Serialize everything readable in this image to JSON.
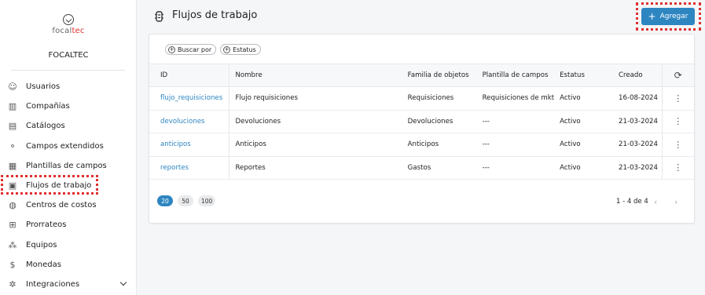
{
  "sidebar": {
    "brand": {
      "prefix": "focal",
      "suffix": "tec"
    },
    "org_name": "FOCALTEC",
    "items": [
      {
        "label": "Usuarios",
        "icon": "users-icon",
        "glyph": "☺"
      },
      {
        "label": "Compañías",
        "icon": "building-icon",
        "glyph": "▥"
      },
      {
        "label": "Catálogos",
        "icon": "catalog-icon",
        "glyph": "▤"
      },
      {
        "label": "Campos extendidos",
        "icon": "extended-fields-icon",
        "glyph": "⚬"
      },
      {
        "label": "Plantillas de campos",
        "icon": "template-icon",
        "glyph": "▦"
      },
      {
        "label": "Flujos de trabajo",
        "icon": "workflow-icon",
        "glyph": "▣"
      },
      {
        "label": "Centros de costos",
        "icon": "piggy-bank-icon",
        "glyph": "◍"
      },
      {
        "label": "Prorrateos",
        "icon": "split-icon",
        "glyph": "⊞"
      },
      {
        "label": "Equipos",
        "icon": "team-icon",
        "glyph": "⁂"
      },
      {
        "label": "Monedas",
        "icon": "coin-icon",
        "glyph": "$"
      },
      {
        "label": "Integraciones",
        "icon": "integration-icon",
        "glyph": "✲"
      }
    ]
  },
  "header": {
    "title": "Flujos de trabajo",
    "add_label": "Agregar"
  },
  "filters": {
    "search_by": "Buscar por",
    "status": "Estatus"
  },
  "table": {
    "columns": [
      "ID",
      "Nombre",
      "Familia de objetos",
      "Plantilla de campos",
      "Estatus",
      "Creado"
    ],
    "rows": [
      {
        "id": "flujo_requisiciones",
        "nombre": "Flujo requisiciones",
        "familia": "Requisiciones",
        "plantilla": "Requisiciones de mkt",
        "estatus": "Activo",
        "creado": "16-08-2024"
      },
      {
        "id": "devoluciones",
        "nombre": "Devoluciones",
        "familia": "Devoluciones",
        "plantilla": "---",
        "estatus": "Activo",
        "creado": "21-03-2024"
      },
      {
        "id": "anticipos",
        "nombre": "Anticipos",
        "familia": "Anticipos",
        "plantilla": "---",
        "estatus": "Activo",
        "creado": "21-03-2024"
      },
      {
        "id": "reportes",
        "nombre": "Reportes",
        "familia": "Gastos",
        "plantilla": "---",
        "estatus": "Activo",
        "creado": "21-03-2024"
      }
    ]
  },
  "pagination": {
    "page_sizes": [
      "20",
      "50",
      "100"
    ],
    "selected_page_size": "20",
    "range": "1 - 4 de 4"
  },
  "colors": {
    "accent": "#2e86c1",
    "highlight": "#e0302f"
  }
}
